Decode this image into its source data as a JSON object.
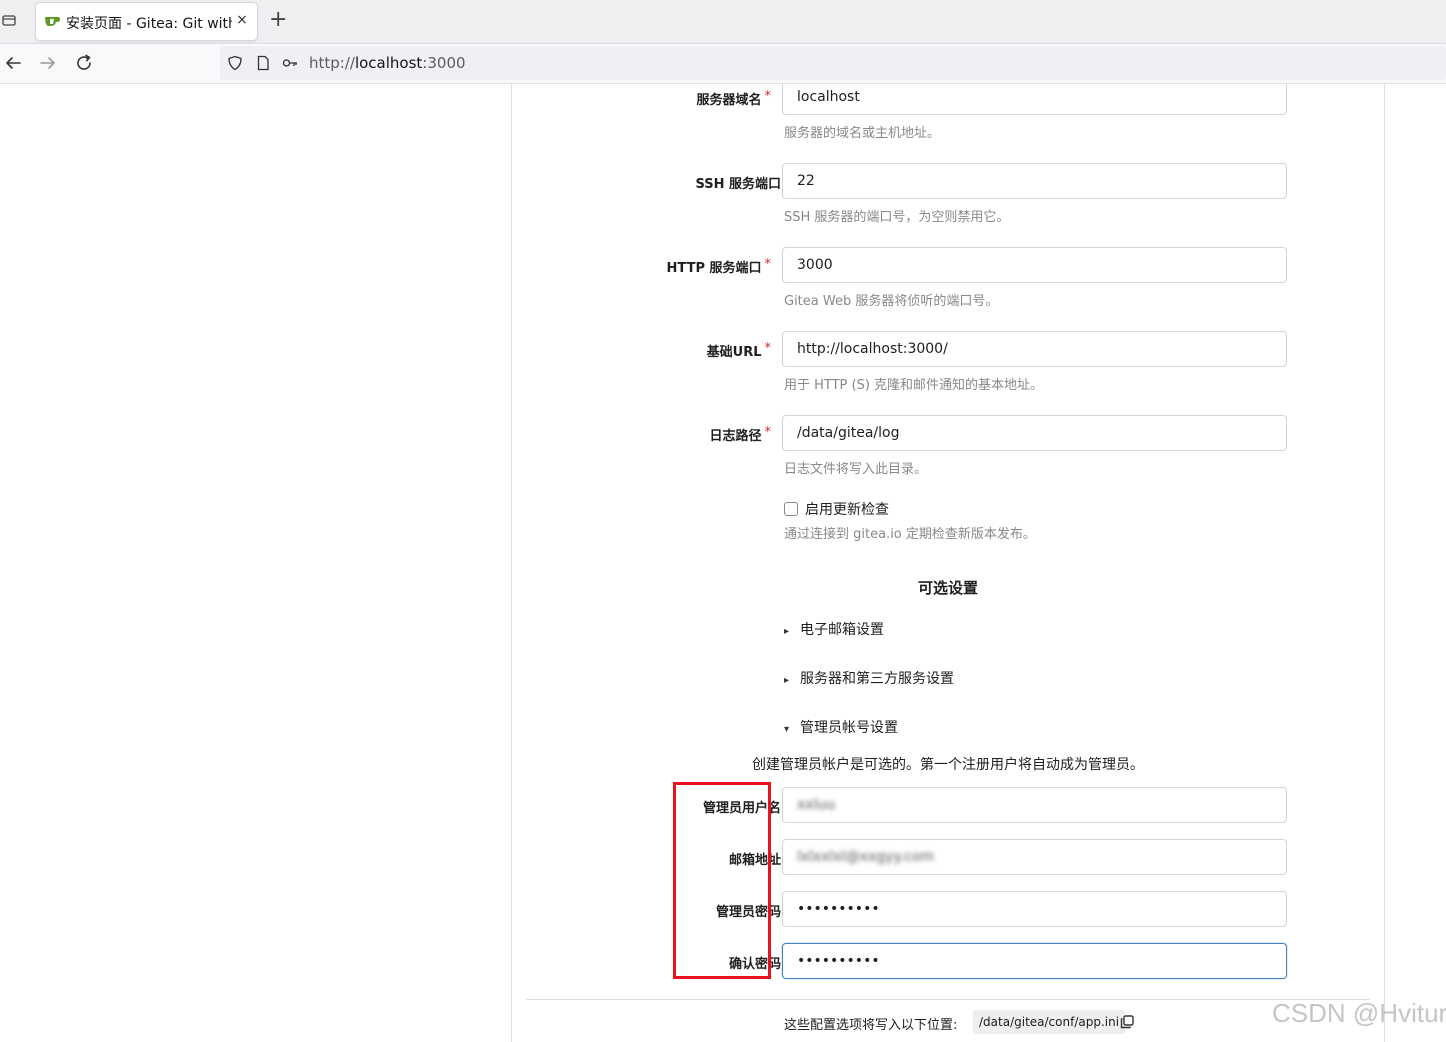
{
  "browser": {
    "tab_title": "安装页面 - Gitea: Git with",
    "tab_close": "×",
    "new_tab": "+",
    "url_scheme": "http://",
    "url_host": "localhost",
    "url_port": ":3000"
  },
  "form": {
    "domain_label": "服务器域名",
    "domain_value": "localhost",
    "domain_help": "服务器的域名或主机地址。",
    "ssh_label": "SSH 服务端口",
    "ssh_value": "22",
    "ssh_help": "SSH 服务器的端口号，为空则禁用它。",
    "http_label": "HTTP 服务端口",
    "http_value": "3000",
    "http_help": "Gitea Web 服务器将侦听的端口号。",
    "baseurl_label": "基础URL",
    "baseurl_value": "http://localhost:3000/",
    "baseurl_help": "用于 HTTP (S) 克隆和邮件通知的基本地址。",
    "log_label": "日志路径",
    "log_value": "/data/gitea/log",
    "log_help": "日志文件将写入此目录。",
    "update_check_label": "启用更新检查",
    "update_check_help": "通过连接到 gitea.io 定期检查新版本发布。",
    "required_mark": "*"
  },
  "optional": {
    "title": "可选设置",
    "email_settings": "电子邮箱设置",
    "server_settings": "服务器和第三方服务设置",
    "admin_settings": "管理员帐号设置",
    "collapsed_marker": "▸",
    "expanded_marker": "▾",
    "admin_note": "创建管理员帐户是可选的。第一个注册用户将自动成为管理员。"
  },
  "admin": {
    "username_label": "管理员用户名",
    "username_value": "xxluu",
    "email_label": "邮箱地址",
    "email_value": "lxlxxlxl@xxgyy.com",
    "password_label": "管理员密码",
    "password_value": "••••••••••",
    "confirm_label": "确认密码",
    "confirm_value": "••••••••••"
  },
  "footer": {
    "text": "这些配置选项将写入以下位置:",
    "path": "/data/gitea/conf/app.ini"
  },
  "watermark": "CSDN @Hvitur",
  "colors": {
    "required": "#db2828",
    "highlight_box": "#e8111c",
    "focus_border": "#4183c4"
  }
}
